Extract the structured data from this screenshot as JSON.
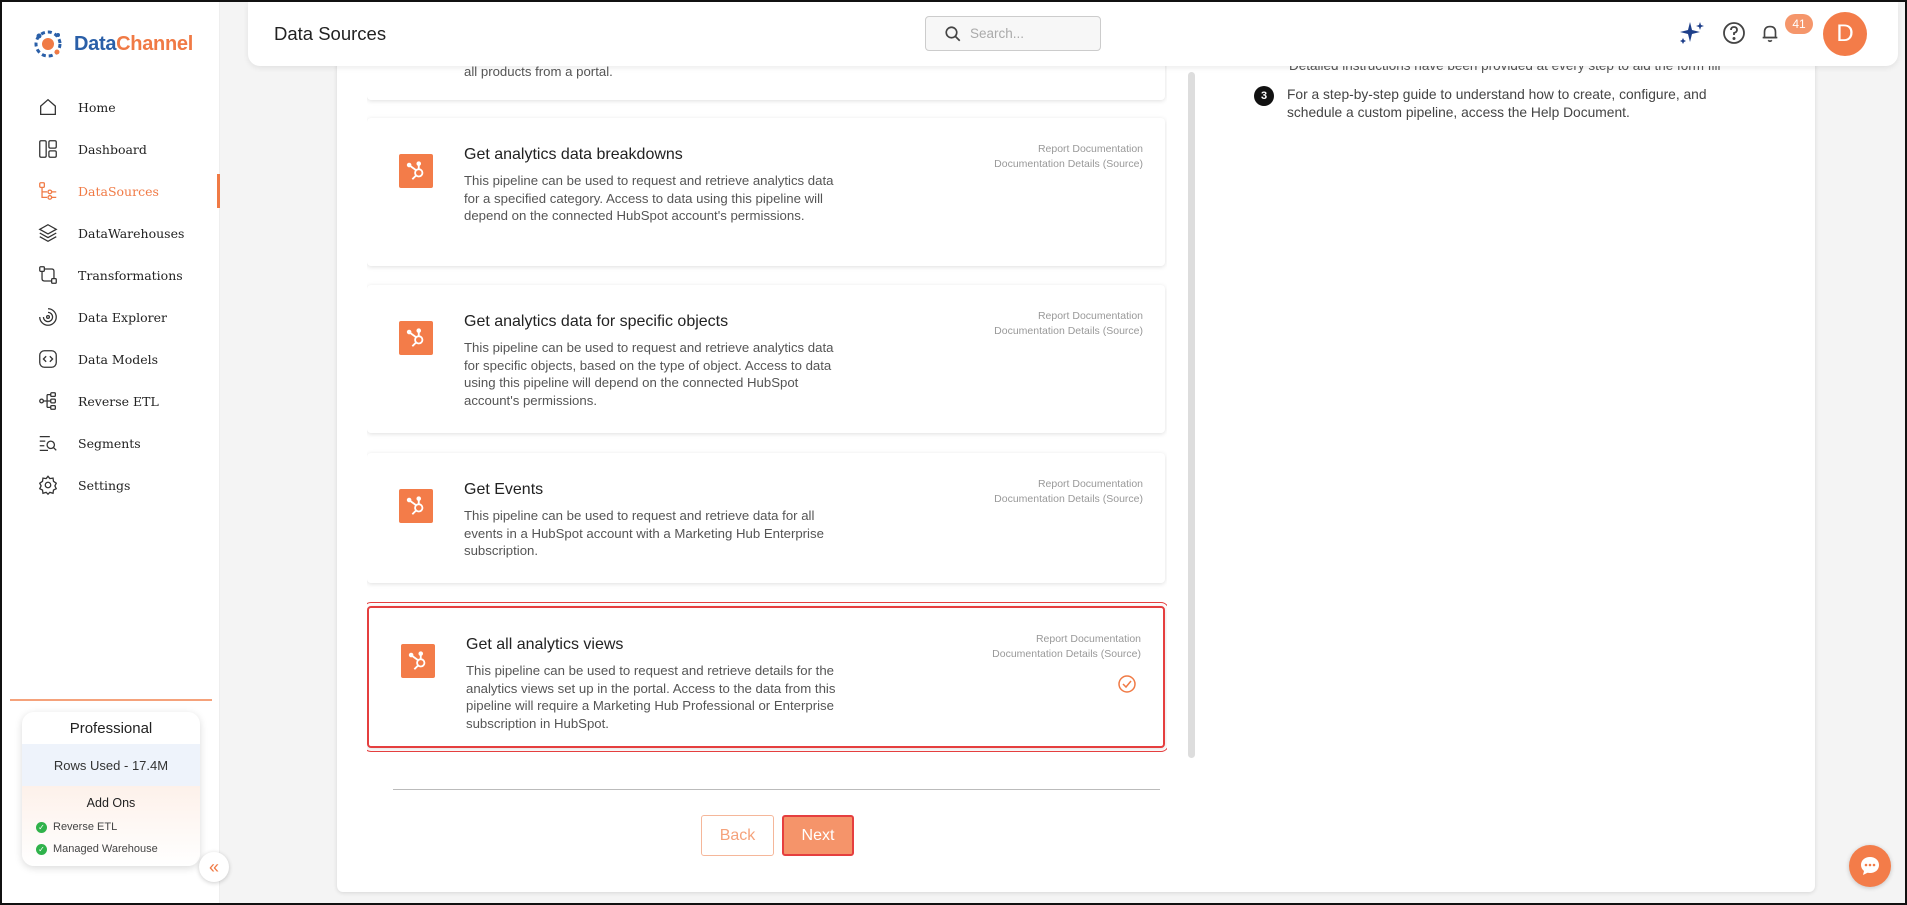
{
  "app": {
    "logo_part1": "Data",
    "logo_part2": "Channel"
  },
  "colors": {
    "accent": "#f37c49",
    "selected_border": "#e53f3f",
    "check_green": "#2fb24a"
  },
  "sidebar": {
    "items": [
      {
        "label": "Home",
        "icon": "home-icon"
      },
      {
        "label": "Dashboard",
        "icon": "dashboard-icon"
      },
      {
        "label": "DataSources",
        "icon": "datasources-icon",
        "active": true
      },
      {
        "label": "DataWarehouses",
        "icon": "datawarehouses-icon"
      },
      {
        "label": "Transformations",
        "icon": "transformations-icon"
      },
      {
        "label": "Data Explorer",
        "icon": "data-explorer-icon"
      },
      {
        "label": "Data Models",
        "icon": "data-models-icon"
      },
      {
        "label": "Reverse ETL",
        "icon": "reverse-etl-icon"
      },
      {
        "label": "Segments",
        "icon": "segments-icon"
      },
      {
        "label": "Settings",
        "icon": "settings-icon"
      }
    ],
    "plan": {
      "name": "Professional",
      "rows_used": "Rows Used - 17.4M",
      "addons_title": "Add Ons",
      "addons": [
        "Reverse ETL",
        "Managed Warehouse"
      ]
    }
  },
  "header": {
    "title": "Data Sources",
    "search_placeholder": "Search...",
    "notification_count": "41",
    "avatar_initial": "D"
  },
  "pipelines": {
    "partial_top_text": "all products from a portal.",
    "cards": [
      {
        "title": "Get analytics data breakdowns",
        "description": "This pipeline can be used to request and retrieve analytics data for a specified category. Access to data using this pipeline will depend on the connected HubSpot account's permissions.",
        "link1": "Report Documentation",
        "link2": "Documentation Details (Source)"
      },
      {
        "title": "Get analytics data for specific objects",
        "description": "This pipeline can be used to request and retrieve analytics data for specific objects, based on the type of object. Access to data using this pipeline will depend on the connected HubSpot account's permissions.",
        "link1": "Report Documentation",
        "link2": "Documentation Details (Source)"
      },
      {
        "title": "Get Events",
        "description": "This pipeline can be used to request and retrieve data for all events in a HubSpot account with a Marketing Hub Enterprise subscription.",
        "link1": "Report Documentation",
        "link2": "Documentation Details (Source)"
      },
      {
        "title": "Get all analytics views",
        "description": "This pipeline can be used to request and retrieve details for the analytics views set up in the portal. Access to the data from this pipeline will require a Marketing Hub Professional or Enterprise subscription in HubSpot.",
        "link1": "Report Documentation",
        "link2": "Documentation Details (Source)",
        "selected": true
      }
    ]
  },
  "buttons": {
    "back": "Back",
    "next": "Next"
  },
  "instructions": {
    "line_partial": "Detailed instructions have been provided at every step to aid the form fill",
    "item3_number": "3",
    "item3_text": "For a step-by-step guide to understand how to create, configure, and schedule a custom pipeline, access the Help Document."
  }
}
